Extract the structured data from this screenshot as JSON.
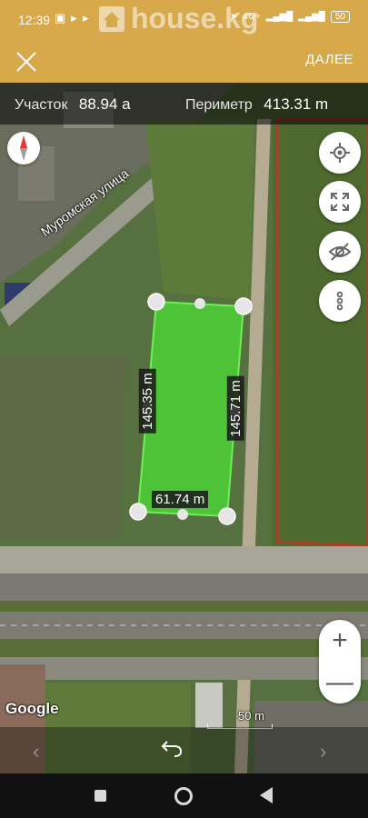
{
  "status_bar": {
    "time": "12:39",
    "battery": "50",
    "network": "4G+"
  },
  "watermark": {
    "text": "house.kg"
  },
  "app_bar": {
    "next_label": "ДАЛЕЕ"
  },
  "measurements": {
    "area_label": "Участок",
    "area_value": "88.94 а",
    "perimeter_label": "Периметр",
    "perimeter_value": "413.31 m"
  },
  "map": {
    "street_name": "Муромская улица",
    "dimensions": {
      "left_side": "145.35 m",
      "right_side": "145.71 m",
      "bottom_side": "61.74 m"
    },
    "polygon_color": "#4cd137",
    "provider": "Google",
    "scale_label": "50 m"
  },
  "icons": {
    "compass": "compass-icon",
    "location": "location-target-icon",
    "fullscreen": "fullscreen-icon",
    "hide": "eye-off-icon",
    "more": "more-vertical-icon",
    "zoom_in": "plus-icon",
    "zoom_out": "minus-icon",
    "undo": "undo-icon"
  },
  "zoom": {
    "in": "+",
    "out": "—"
  }
}
